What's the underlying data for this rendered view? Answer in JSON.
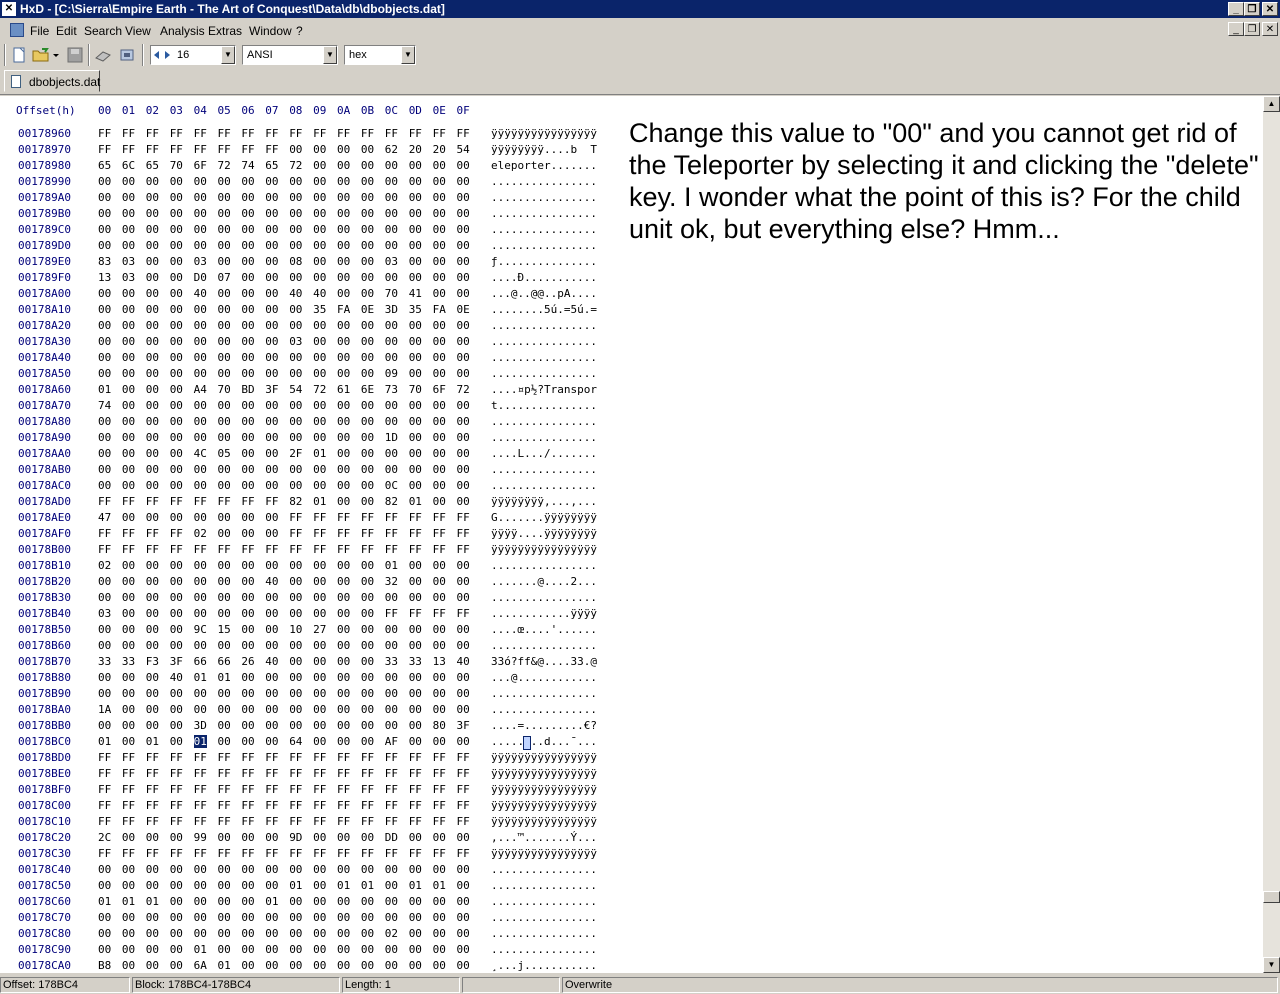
{
  "window": {
    "title": "HxD - [C:\\Sierra\\Empire Earth - The Art of Conquest\\Data\\db\\dbobjects.dat]",
    "app_icon": "hxd-icon"
  },
  "menu": [
    "File",
    "Edit",
    "Search",
    "View",
    "Analysis",
    "Extras",
    "Window",
    "?"
  ],
  "toolbar": {
    "bytes_per_row": "16",
    "charset": "ANSI",
    "offset_base": "hex"
  },
  "tab": {
    "label": "dbobjects.dat"
  },
  "header": {
    "offset_label": "Offset(h)",
    "columns": [
      "00",
      "01",
      "02",
      "03",
      "04",
      "05",
      "06",
      "07",
      "08",
      "09",
      "0A",
      "0B",
      "0C",
      "0D",
      "0E",
      "0F"
    ]
  },
  "rows": [
    {
      "offset": "00178960",
      "bytes": "FF FF FF FF FF FF FF FF FF FF FF FF FF FF FF FF",
      "ascii": "ÿÿÿÿÿÿÿÿÿÿÿÿÿÿÿÿ"
    },
    {
      "offset": "00178970",
      "bytes": "FF FF FF FF FF FF FF FF 00 00 00 00 62 20 20 54",
      "ascii": "ÿÿÿÿÿÿÿÿ....b  T"
    },
    {
      "offset": "00178980",
      "bytes": "65 6C 65 70 6F 72 74 65 72 00 00 00 00 00 00 00",
      "ascii": "eleporter......."
    },
    {
      "offset": "00178990",
      "bytes": "00 00 00 00 00 00 00 00 00 00 00 00 00 00 00 00",
      "ascii": "................"
    },
    {
      "offset": "001789A0",
      "bytes": "00 00 00 00 00 00 00 00 00 00 00 00 00 00 00 00",
      "ascii": "................"
    },
    {
      "offset": "001789B0",
      "bytes": "00 00 00 00 00 00 00 00 00 00 00 00 00 00 00 00",
      "ascii": "................"
    },
    {
      "offset": "001789C0",
      "bytes": "00 00 00 00 00 00 00 00 00 00 00 00 00 00 00 00",
      "ascii": "................"
    },
    {
      "offset": "001789D0",
      "bytes": "00 00 00 00 00 00 00 00 00 00 00 00 00 00 00 00",
      "ascii": "................"
    },
    {
      "offset": "001789E0",
      "bytes": "83 03 00 00 03 00 00 00 08 00 00 00 03 00 00 00",
      "ascii": "ƒ..............."
    },
    {
      "offset": "001789F0",
      "bytes": "13 03 00 00 D0 07 00 00 00 00 00 00 00 00 00 00",
      "ascii": "....Ð..........."
    },
    {
      "offset": "00178A00",
      "bytes": "00 00 00 00 40 00 00 00 40 40 00 00 70 41 00 00",
      "ascii": "...@..@@..pA...."
    },
    {
      "offset": "00178A10",
      "bytes": "00 00 00 00 00 00 00 00 00 35 FA 0E 3D 35 FA 0E 3D",
      "ascii": "........5ú.=5ú.="
    },
    {
      "offset": "00178A20",
      "bytes": "00 00 00 00 00 00 00 00 00 00 00 00 00 00 00 00",
      "ascii": "................"
    },
    {
      "offset": "00178A30",
      "bytes": "00 00 00 00 00 00 00 00 03 00 00 00 00 00 00 00",
      "ascii": "................"
    },
    {
      "offset": "00178A40",
      "bytes": "00 00 00 00 00 00 00 00 00 00 00 00 00 00 00 00",
      "ascii": "................"
    },
    {
      "offset": "00178A50",
      "bytes": "00 00 00 00 00 00 00 00 00 00 00 00 09 00 00 00",
      "ascii": "................"
    },
    {
      "offset": "00178A60",
      "bytes": "01 00 00 00 A4 70 BD 3F 54 72 61 6E 73 70 6F 72",
      "ascii": "....¤p½?Transpor"
    },
    {
      "offset": "00178A70",
      "bytes": "74 00 00 00 00 00 00 00 00 00 00 00 00 00 00 00",
      "ascii": "t..............."
    },
    {
      "offset": "00178A80",
      "bytes": "00 00 00 00 00 00 00 00 00 00 00 00 00 00 00 00",
      "ascii": "................"
    },
    {
      "offset": "00178A90",
      "bytes": "00 00 00 00 00 00 00 00 00 00 00 00 1D 00 00 00",
      "ascii": "................"
    },
    {
      "offset": "00178AA0",
      "bytes": "00 00 00 00 4C 05 00 00 2F 01 00 00 00 00 00 00",
      "ascii": "....L.../......."
    },
    {
      "offset": "00178AB0",
      "bytes": "00 00 00 00 00 00 00 00 00 00 00 00 00 00 00 00",
      "ascii": "................"
    },
    {
      "offset": "00178AC0",
      "bytes": "00 00 00 00 00 00 00 00 00 00 00 00 0C 00 00 00",
      "ascii": "................"
    },
    {
      "offset": "00178AD0",
      "bytes": "FF FF FF FF FF FF FF FF 82 01 00 00 82 01 00 00",
      "ascii": "ÿÿÿÿÿÿÿÿ‚...‚..."
    },
    {
      "offset": "00178AE0",
      "bytes": "47 00 00 00 00 00 00 00 FF FF FF FF FF FF FF FF",
      "ascii": "G.......ÿÿÿÿÿÿÿÿ"
    },
    {
      "offset": "00178AF0",
      "bytes": "FF FF FF FF 02 00 00 00 FF FF FF FF FF FF FF FF",
      "ascii": "ÿÿÿÿ....ÿÿÿÿÿÿÿÿ"
    },
    {
      "offset": "00178B00",
      "bytes": "FF FF FF FF FF FF FF FF FF FF FF FF FF FF FF FF",
      "ascii": "ÿÿÿÿÿÿÿÿÿÿÿÿÿÿÿÿ"
    },
    {
      "offset": "00178B10",
      "bytes": "02 00 00 00 00 00 00 00 00 00 00 00 01 00 00 00",
      "ascii": "................"
    },
    {
      "offset": "00178B20",
      "bytes": "00 00 00 00 00 00 00 40 00 00 00 00 32 00 00 00",
      "ascii": ".......@....2..."
    },
    {
      "offset": "00178B30",
      "bytes": "00 00 00 00 00 00 00 00 00 00 00 00 00 00 00 00",
      "ascii": "................"
    },
    {
      "offset": "00178B40",
      "bytes": "03 00 00 00 00 00 00 00 00 00 00 00 FF FF FF FF",
      "ascii": "............ÿÿÿÿ"
    },
    {
      "offset": "00178B50",
      "bytes": "00 00 00 00 9C 15 00 00 10 27 00 00 00 00 00 00",
      "ascii": "....œ....'......"
    },
    {
      "offset": "00178B60",
      "bytes": "00 00 00 00 00 00 00 00 00 00 00 00 00 00 00 00",
      "ascii": "................"
    },
    {
      "offset": "00178B70",
      "bytes": "33 33 F3 3F 66 66 26 40 00 00 00 00 33 33 13 40",
      "ascii": "33ó?ff&@....33.@"
    },
    {
      "offset": "00178B80",
      "bytes": "00 00 00 40 01 01 00 00 00 00 00 00 00 00 00 00",
      "ascii": "...@............"
    },
    {
      "offset": "00178B90",
      "bytes": "00 00 00 00 00 00 00 00 00 00 00 00 00 00 00 00",
      "ascii": "................"
    },
    {
      "offset": "00178BA0",
      "bytes": "1A 00 00 00 00 00 00 00 00 00 00 00 00 00 00 00",
      "ascii": "................"
    },
    {
      "offset": "00178BB0",
      "bytes": "00 00 00 00 3D 00 00 00 00 00 00 00 00 00 80 3F",
      "ascii": "....=.........€?"
    },
    {
      "offset": "00178BC0",
      "bytes": "01 00 01 00 01 00 00 00 64 00 00 00 AF 00 00 00",
      "ascii": "........d...¯...",
      "selected_index": 4
    },
    {
      "offset": "00178BD0",
      "bytes": "FF FF FF FF FF FF FF FF FF FF FF FF FF FF FF FF",
      "ascii": "ÿÿÿÿÿÿÿÿÿÿÿÿÿÿÿÿ"
    },
    {
      "offset": "00178BE0",
      "bytes": "FF FF FF FF FF FF FF FF FF FF FF FF FF FF FF FF",
      "ascii": "ÿÿÿÿÿÿÿÿÿÿÿÿÿÿÿÿ"
    },
    {
      "offset": "00178BF0",
      "bytes": "FF FF FF FF FF FF FF FF FF FF FF FF FF FF FF FF",
      "ascii": "ÿÿÿÿÿÿÿÿÿÿÿÿÿÿÿÿ"
    },
    {
      "offset": "00178C00",
      "bytes": "FF FF FF FF FF FF FF FF FF FF FF FF FF FF FF FF",
      "ascii": "ÿÿÿÿÿÿÿÿÿÿÿÿÿÿÿÿ"
    },
    {
      "offset": "00178C10",
      "bytes": "FF FF FF FF FF FF FF FF FF FF FF FF FF FF FF FF",
      "ascii": "ÿÿÿÿÿÿÿÿÿÿÿÿÿÿÿÿ"
    },
    {
      "offset": "00178C20",
      "bytes": "2C 00 00 00 99 00 00 00 9D 00 00 00 DD 00 00 00",
      "ascii": ",...™.......Ý..."
    },
    {
      "offset": "00178C30",
      "bytes": "FF FF FF FF FF FF FF FF FF FF FF FF FF FF FF FF",
      "ascii": "ÿÿÿÿÿÿÿÿÿÿÿÿÿÿÿÿ"
    },
    {
      "offset": "00178C40",
      "bytes": "00 00 00 00 00 00 00 00 00 00 00 00 00 00 00 00",
      "ascii": "................"
    },
    {
      "offset": "00178C50",
      "bytes": "00 00 00 00 00 00 00 00 01 00 01 01 00 01 01 00",
      "ascii": "................"
    },
    {
      "offset": "00178C60",
      "bytes": "01 01 01 00 00 00 00 01 00 00 00 00 00 00 00 00",
      "ascii": "................"
    },
    {
      "offset": "00178C70",
      "bytes": "00 00 00 00 00 00 00 00 00 00 00 00 00 00 00 00",
      "ascii": "................"
    },
    {
      "offset": "00178C80",
      "bytes": "00 00 00 00 00 00 00 00 00 00 00 00 02 00 00 00",
      "ascii": "................"
    },
    {
      "offset": "00178C90",
      "bytes": "00 00 00 00 01 00 00 00 00 00 00 00 00 00 00 00",
      "ascii": "................"
    },
    {
      "offset": "00178CA0",
      "bytes": "B8 00 00 00 6A 01 00 00 00 00 00 00 00 00 00 00",
      "ascii": "¸...j..........."
    }
  ],
  "annotation": "Change this value to \"00\" and you cannot get rid of the Teleporter by selecting it and clicking the \"delete\" key. I wonder what the point of this is? For the child unit ok, but everything else? Hmm...",
  "status": {
    "offset": "Offset: 178BC4",
    "block": "Block: 178BC4-178BC4",
    "length": "Length: 1",
    "empty": "",
    "mode": "Overwrite"
  },
  "colors": {
    "title_bar": "#0a246a",
    "offset_text": "#00007a",
    "selection": "#0a246a"
  }
}
